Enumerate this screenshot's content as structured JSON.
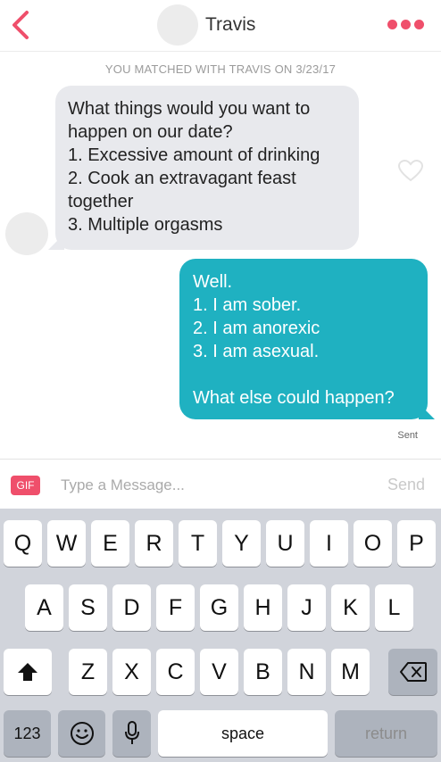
{
  "header": {
    "contact_name": "Travis",
    "back_icon": "chevron-left-icon",
    "more_icon": "more-dots-icon",
    "accent_color": "#ef4f6b"
  },
  "chat": {
    "match_notice": "YOU MATCHED WITH TRAVIS ON 3/23/17",
    "incoming_message": {
      "lines": [
        "What things would you want to",
        "happen on our date?",
        "1. Excessive amount of drinking",
        "2. Cook an extravagant feast",
        "together",
        "3. Multiple orgasms"
      ],
      "bubble_color": "#e8e9ed"
    },
    "outgoing_message": {
      "lines": [
        "Well.",
        "1. I am sober.",
        "2. I am anorexic",
        "3. I am asexual.",
        "",
        "What else could happen?"
      ],
      "bubble_color": "#1fb1c1"
    },
    "status": "Sent"
  },
  "composer": {
    "gif_label": "GIF",
    "placeholder": "Type a Message...",
    "value": "",
    "send_label": "Send"
  },
  "keyboard": {
    "row1": [
      "Q",
      "W",
      "E",
      "R",
      "T",
      "Y",
      "U",
      "I",
      "O",
      "P"
    ],
    "row2": [
      "A",
      "S",
      "D",
      "F",
      "G",
      "H",
      "J",
      "K",
      "L"
    ],
    "row3": [
      "Z",
      "X",
      "C",
      "V",
      "B",
      "N",
      "M"
    ],
    "numbers_label": "123",
    "space_label": "space",
    "return_label": "return",
    "shift_icon": "shift-arrow-icon",
    "backspace_icon": "backspace-icon",
    "emoji_icon": "emoji-icon",
    "mic_icon": "microphone-icon"
  }
}
